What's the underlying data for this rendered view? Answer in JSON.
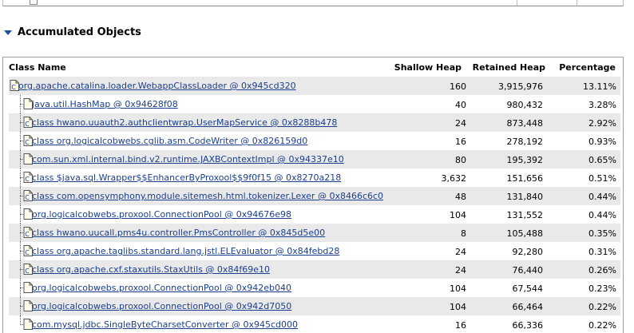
{
  "section": {
    "title": "Accumulated Objects"
  },
  "table": {
    "headers": {
      "class_name": "Class Name",
      "shallow_heap": "Shallow Heap",
      "retained_heap": "Retained Heap",
      "percentage": "Percentage"
    },
    "rows": [
      {
        "name": "org.apache.catalina.loader.WebappClassLoader @ 0x945cd320",
        "shallow": "160",
        "retained": "3,915,976",
        "pct": "13.11%",
        "icon": "class-file-icon",
        "level": 0
      },
      {
        "name": "java.util.HashMap @ 0x94628f08",
        "shallow": "40",
        "retained": "980,432",
        "pct": "3.28%",
        "icon": "object-file-icon",
        "level": 1
      },
      {
        "name": "class hwano.uuauth2.authclientwrap.UserMapService @ 0x8288b478",
        "shallow": "24",
        "retained": "873,448",
        "pct": "2.92%",
        "icon": "class-file-icon",
        "level": 1
      },
      {
        "name": "class org.logicalcobwebs.cglib.asm.CodeWriter @ 0x826159d0",
        "shallow": "16",
        "retained": "278,192",
        "pct": "0.93%",
        "icon": "class-file-icon",
        "level": 1
      },
      {
        "name": "com.sun.xml.internal.bind.v2.runtime.JAXBContextImpl @ 0x94337e10",
        "shallow": "80",
        "retained": "195,392",
        "pct": "0.65%",
        "icon": "object-file-icon",
        "level": 1
      },
      {
        "name": "class $java.sql.Wrapper$$EnhancerByProxool$$9f0f15 @ 0x8270a218",
        "shallow": "3,632",
        "retained": "151,656",
        "pct": "0.51%",
        "icon": "class-file-icon",
        "level": 1
      },
      {
        "name": "class com.opensymphony.module.sitemesh.html.tokenizer.Lexer @ 0x8466c6c0",
        "shallow": "48",
        "retained": "131,840",
        "pct": "0.44%",
        "icon": "class-file-icon",
        "level": 1
      },
      {
        "name": "org.logicalcobwebs.proxool.ConnectionPool @ 0x94676e98",
        "shallow": "104",
        "retained": "131,552",
        "pct": "0.44%",
        "icon": "object-file-icon",
        "level": 1
      },
      {
        "name": "class hwano.uucall.pms4u.controller.PmsController @ 0x845d5e00",
        "shallow": "8",
        "retained": "105,488",
        "pct": "0.35%",
        "icon": "class-file-icon",
        "level": 1
      },
      {
        "name": "class org.apache.taglibs.standard.lang.jstl.ELEvaluator @ 0x84febd28",
        "shallow": "24",
        "retained": "92,280",
        "pct": "0.31%",
        "icon": "class-file-icon",
        "level": 1
      },
      {
        "name": "class org.apache.cxf.staxutils.StaxUtils @ 0x84f69e10",
        "shallow": "24",
        "retained": "76,440",
        "pct": "0.26%",
        "icon": "class-file-icon",
        "level": 1
      },
      {
        "name": "org.logicalcobwebs.proxool.ConnectionPool @ 0x942eb040",
        "shallow": "104",
        "retained": "67,544",
        "pct": "0.23%",
        "icon": "object-file-icon",
        "level": 1
      },
      {
        "name": "org.logicalcobwebs.proxool.ConnectionPool @ 0x942d7050",
        "shallow": "104",
        "retained": "66,464",
        "pct": "0.22%",
        "icon": "object-file-icon",
        "level": 1
      },
      {
        "name": "com.mysql.jdbc.SingleByteCharsetConverter @ 0x945cd000",
        "shallow": "16",
        "retained": "66,336",
        "pct": "0.22%",
        "icon": "object-file-icon",
        "level": 1
      }
    ]
  }
}
